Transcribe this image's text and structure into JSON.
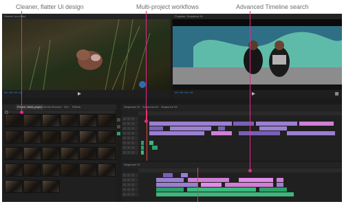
{
  "callouts": {
    "ui": "Cleaner, flatter Ui design",
    "multi": "Multi-project workflows",
    "search": "Advanced Timeline search",
    "accent_color": "#e8278c"
  },
  "source_monitor": {
    "title": "Source: (no clips)",
    "timecode": "00:00:00:00"
  },
  "program_monitor": {
    "title": "Program: Sequence 01",
    "timecode": "00:00:00:00"
  },
  "project": {
    "tabs": [
      "Project: Multi-project",
      "Media Browser",
      "Info",
      "Effects"
    ],
    "active_tab": 0
  },
  "timeline_top": {
    "tabs": [
      "Sequence 01",
      "Sequence 02",
      "Sequence 03"
    ]
  },
  "timeline_bottom": {
    "tabs": [
      "Sequence 01"
    ]
  },
  "colors": {
    "video_clip": "#9b7fd1",
    "audio_clip": "#2da06a",
    "search_match": "#e28be8",
    "playhead": "#e0463d",
    "timecode": "#2f7fd6"
  },
  "icons": [
    "play-icon",
    "marker-icon",
    "wrench-icon",
    "search-icon",
    "lock-icon",
    "eye-icon",
    "mute-icon",
    "solo-icon",
    "razor-icon",
    "selection-icon"
  ]
}
